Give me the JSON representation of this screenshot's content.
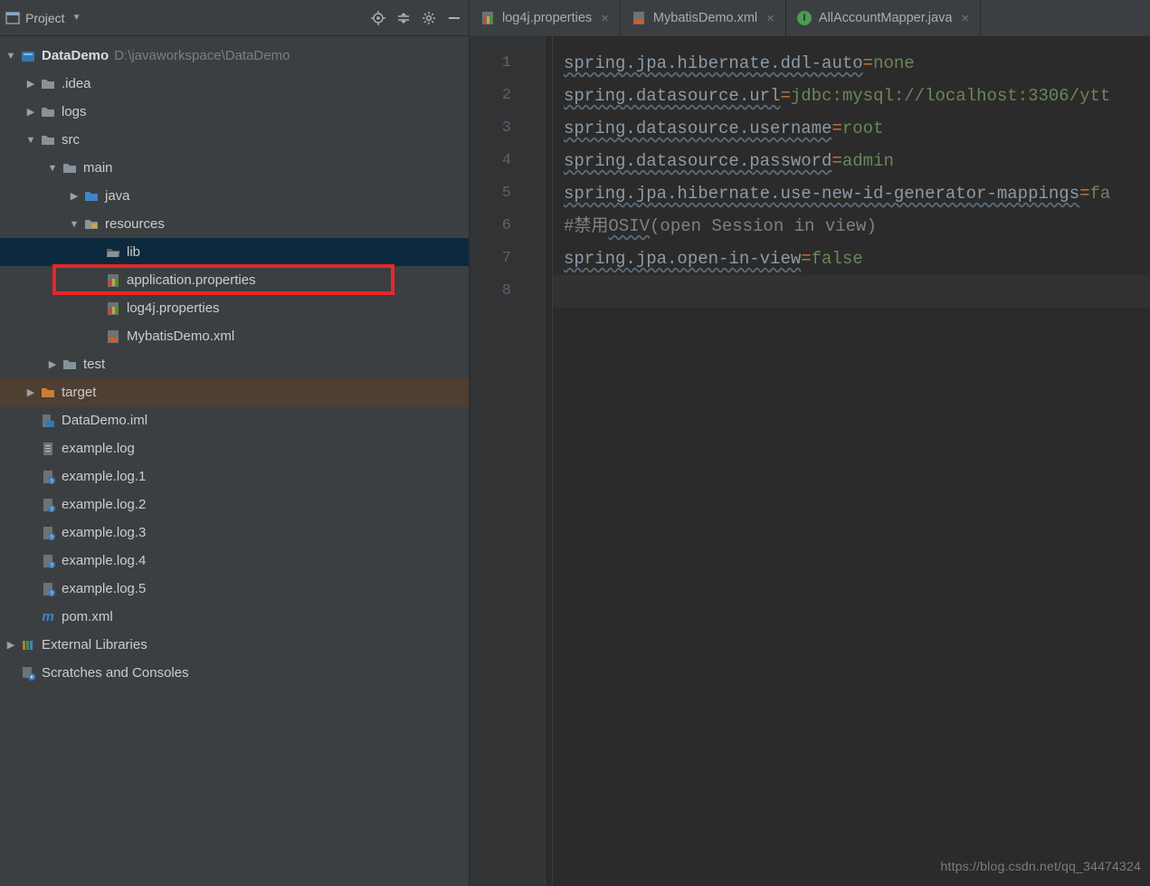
{
  "sidebar": {
    "title": "Project",
    "actions": [
      "target",
      "collapse",
      "settings",
      "minimize"
    ]
  },
  "project": {
    "root": {
      "name": "DataDemo",
      "path": "D:\\javaworkspace\\DataDemo"
    },
    "idea": ".idea",
    "logs": "logs",
    "src": "src",
    "main": "main",
    "java": "java",
    "resources": "resources",
    "lib": "lib",
    "appprops": "application.properties",
    "log4j": "log4j.properties",
    "mybatis": "MybatisDemo.xml",
    "test": "test",
    "target": "target",
    "iml": "DataDemo.iml",
    "exlog": "example.log",
    "exlog1": "example.log.1",
    "exlog2": "example.log.2",
    "exlog3": "example.log.3",
    "exlog4": "example.log.4",
    "exlog5": "example.log.5",
    "pom": "pom.xml",
    "extlib": "External Libraries",
    "scratches": "Scratches and Consoles"
  },
  "tabs": [
    {
      "label": "log4j.properties",
      "type": "props",
      "active": false
    },
    {
      "label": "MybatisDemo.xml",
      "type": "xml",
      "active": false
    },
    {
      "label": "AllAccountMapper.java",
      "type": "java",
      "active": false
    }
  ],
  "code": {
    "lines": [
      {
        "n": 1,
        "key": "spring.jpa.hibernate.ddl-auto",
        "val": "none"
      },
      {
        "n": 2,
        "key": "spring.datasource.url",
        "val": "jdbc:mysql://localhost:3306/ytt"
      },
      {
        "n": 3,
        "key": "spring.datasource.username",
        "val": "root"
      },
      {
        "n": 4,
        "key": "spring.datasource.password",
        "val": "admin"
      },
      {
        "n": 5,
        "key": "spring.jpa.hibernate.use-new-id-generator-mappings",
        "val": "fa"
      },
      {
        "n": 6,
        "comment_prefix": "#禁用",
        "comment_u": "OSIV",
        "comment_suffix": "(open Session in view)"
      },
      {
        "n": 7,
        "key": "spring.jpa.open-in-view",
        "val": "false"
      },
      {
        "n": 8
      }
    ]
  },
  "watermark": "https://blog.csdn.net/qq_34474324"
}
